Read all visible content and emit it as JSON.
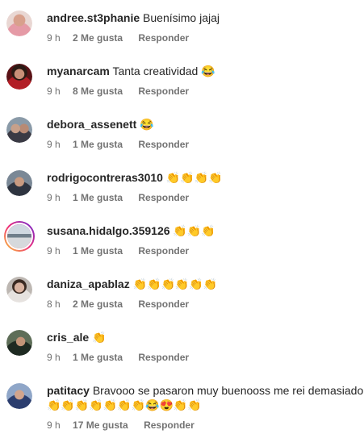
{
  "comments": [
    {
      "username": "andree.st3phanie",
      "text": "Buenísimo jajaj",
      "time": "9 h",
      "likes": "2 Me gusta",
      "reply": "Responder"
    },
    {
      "username": "myanarcam",
      "text": "Tanta creatividad 😂",
      "time": "9 h",
      "likes": "8 Me gusta",
      "reply": "Responder"
    },
    {
      "username": "debora_assenett",
      "text": "😂",
      "time": "9 h",
      "likes": "1 Me gusta",
      "reply": "Responder"
    },
    {
      "username": "rodrigocontreras3010",
      "text": "👏👏👏👏",
      "time": "9 h",
      "likes": "1 Me gusta",
      "reply": "Responder"
    },
    {
      "username": "susana.hidalgo.359126",
      "text": "👏👏👏",
      "time": "9 h",
      "likes": "1 Me gusta",
      "reply": "Responder"
    },
    {
      "username": "daniza_apablaz",
      "text": "👏👏👏👏👏👏",
      "time": "8 h",
      "likes": "2 Me gusta",
      "reply": "Responder"
    },
    {
      "username": "cris_ale",
      "text": "👏",
      "time": "9 h",
      "likes": "1 Me gusta",
      "reply": "Responder"
    },
    {
      "username": "patitacy",
      "text": "Bravooo se pasaron muy buenooss me rei demasiado",
      "text2": "👏👏👏👏👏👏👏😂😍👏👏",
      "time": "9 h",
      "likes": "17 Me gusta",
      "reply": "Responder"
    }
  ],
  "colors": {
    "text": "#262626",
    "meta": "#737373",
    "story_ring": "#ee2a7b"
  }
}
